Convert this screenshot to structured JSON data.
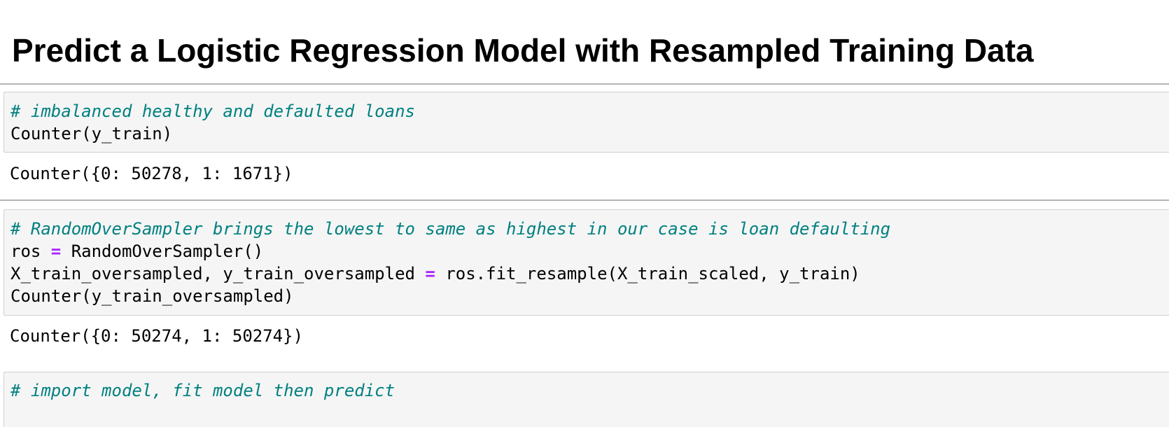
{
  "heading": "Predict a Logistic Regression Model with Resampled Training Data",
  "cells": [
    {
      "lines": [
        {
          "comment": "# imbalanced healthy and defaulted loans"
        },
        {
          "text": "Counter(y_train)"
        }
      ],
      "output": "Counter({0: 50278, 1: 1671})"
    },
    {
      "lines": [
        {
          "comment": "# RandomOverSampler brings the lowest to same as highest in our case is loan defaulting"
        },
        {
          "pre": "ros ",
          "op": "=",
          "post": " RandomOverSampler()"
        },
        {
          "pre": "X_train_oversampled, y_train_oversampled ",
          "op": "=",
          "post": " ros.fit_resample(X_train_scaled, y_train)"
        },
        {
          "text": "Counter(y_train_oversampled)"
        }
      ],
      "output": "Counter({0: 50274, 1: 50274})"
    },
    {
      "lines": [
        {
          "comment": "# import model, fit model then predict"
        }
      ]
    }
  ],
  "colors": {
    "comment": "#008080",
    "operator": "#aa22ff",
    "cell_background": "#f5f5f5",
    "cell_border": "#cfcfcf"
  }
}
